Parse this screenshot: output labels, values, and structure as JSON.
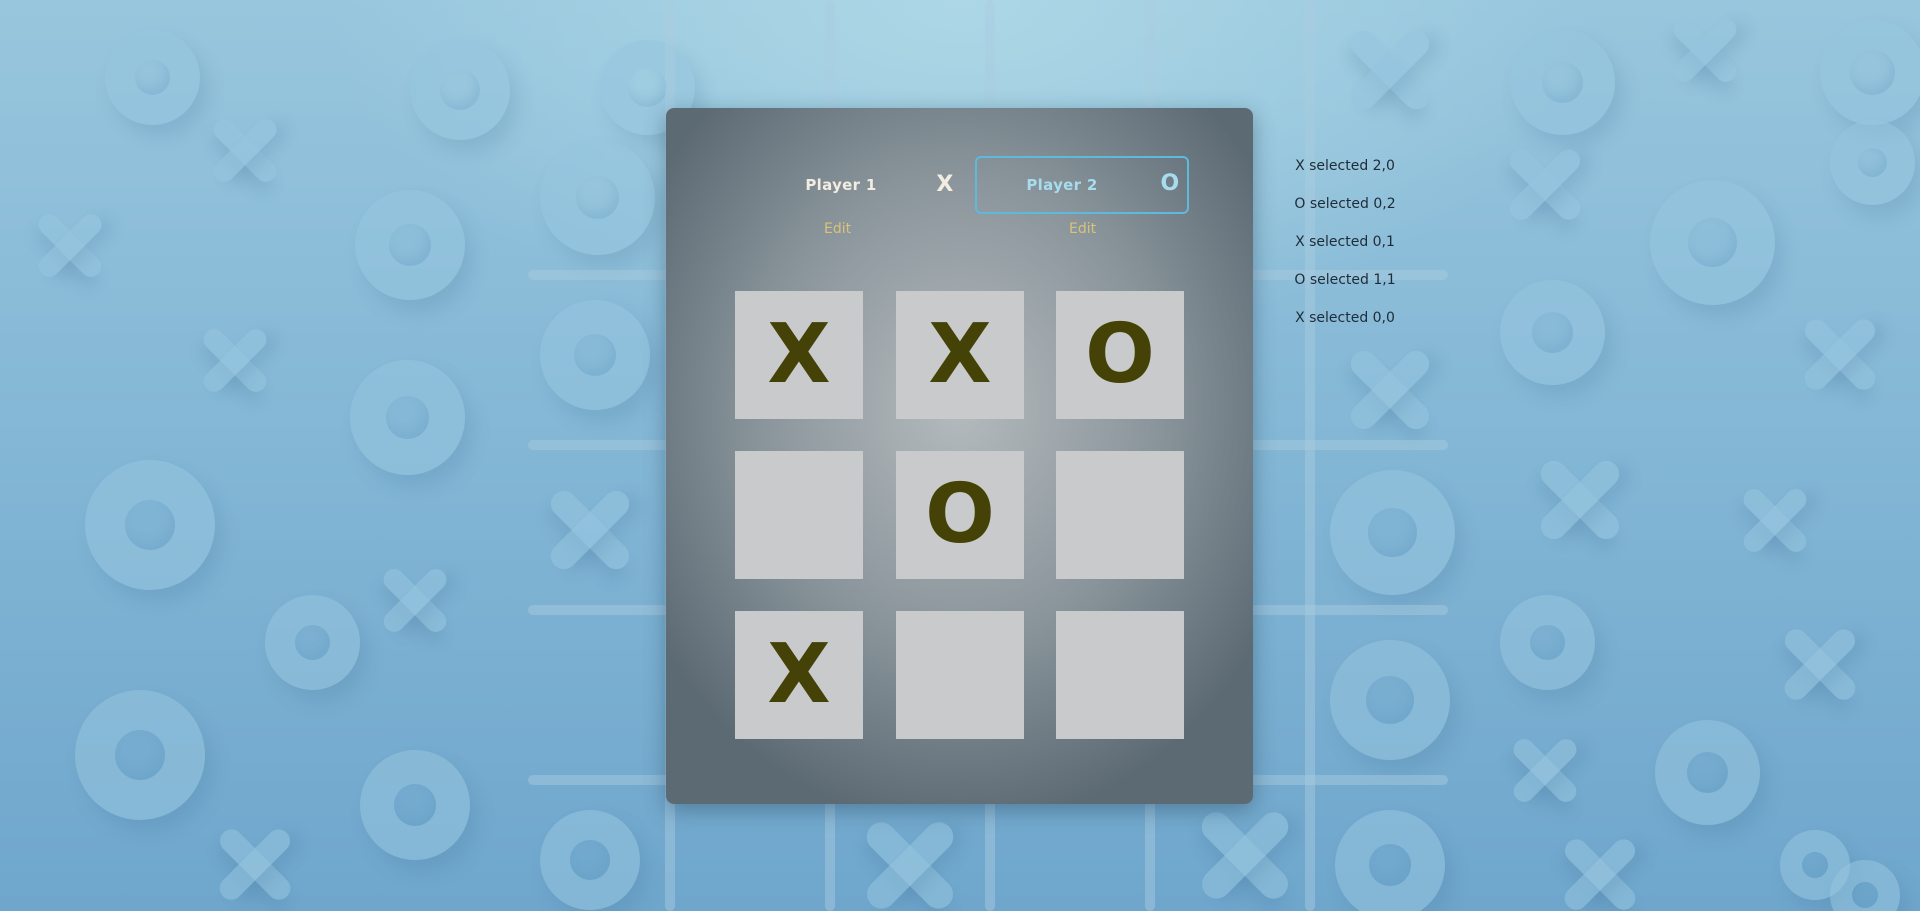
{
  "players": [
    {
      "name": "Player 1",
      "symbol": "X",
      "edit_label": "Edit",
      "active": false
    },
    {
      "name": "Player 2",
      "symbol": "O",
      "edit_label": "Edit",
      "active": true
    }
  ],
  "board": [
    [
      "X",
      "X",
      "O"
    ],
    [
      "",
      "O",
      ""
    ],
    [
      "X",
      "",
      ""
    ]
  ],
  "log": [
    "X selected 2,0",
    "O selected 0,2",
    "X selected 0,1",
    "O selected 1,1",
    "X selected 0,0"
  ],
  "colors": {
    "mark": "#454208",
    "active_border": "#5fb9dc",
    "edit_text": "#d9c27a",
    "cell": "#c9cacb"
  }
}
